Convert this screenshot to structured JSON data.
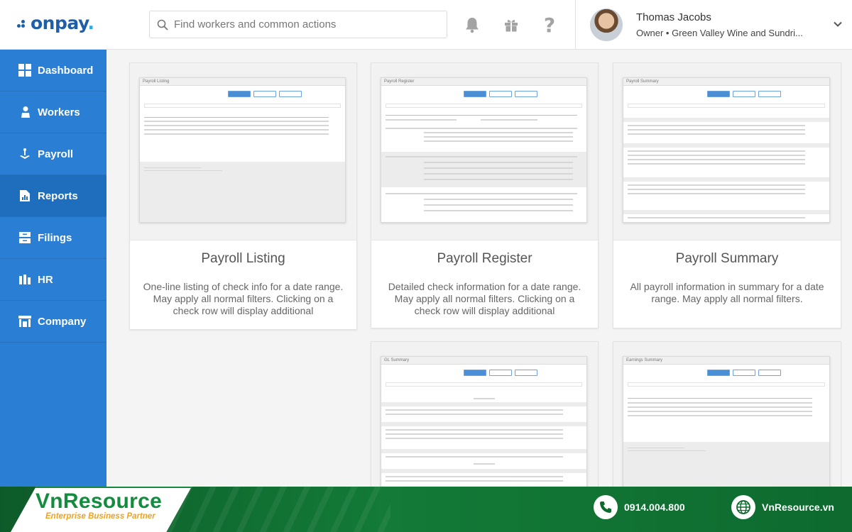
{
  "header": {
    "logo": {
      "prefix": "on",
      "suffix": "pay",
      "mark": "."
    },
    "search_placeholder": "Find workers and common actions",
    "user": {
      "name": "Thomas Jacobs",
      "role": "Owner • Green Valley Wine and Sundri..."
    }
  },
  "sidebar": {
    "items": [
      {
        "label": "Dashboard",
        "icon": "dashboard-icon"
      },
      {
        "label": "Workers",
        "icon": "workers-icon"
      },
      {
        "label": "Payroll",
        "icon": "payroll-icon"
      },
      {
        "label": "Reports",
        "icon": "reports-icon",
        "active": true
      },
      {
        "label": "Filings",
        "icon": "filings-icon"
      },
      {
        "label": "HR",
        "icon": "hr-icon"
      },
      {
        "label": "Company",
        "icon": "company-icon"
      }
    ]
  },
  "reports": [
    {
      "title": "Payroll Listing",
      "preview_title": "Payroll Listing",
      "description": "One-line listing of check info for a date range. May apply all normal filters. Clicking on a check row will display additional"
    },
    {
      "title": "Payroll Register",
      "preview_title": "Payroll Register",
      "description": "Detailed check information for a date range. May apply all normal filters. Clicking on a check row will display additional"
    },
    {
      "title": "Payroll Summary",
      "preview_title": "Payroll Summary",
      "description": "All payroll information in summary for a date range. May apply all normal filters."
    },
    {
      "title": "",
      "preview_title": "GL Summary",
      "description": ""
    },
    {
      "title": "",
      "preview_title": "Earnings Summary",
      "description": ""
    }
  ],
  "footer": {
    "brand": "VnResource",
    "tagline": "Enterprise Business Partner",
    "phone": "0914.004.800",
    "website": "VnResource.vn"
  },
  "colors": {
    "sidebar": "#2a7fd4",
    "sidebar_active": "#1f6dbd",
    "brand_blue": "#1f5fa8",
    "footer_green": "#137a37",
    "accent_orange": "#f0a21c"
  }
}
